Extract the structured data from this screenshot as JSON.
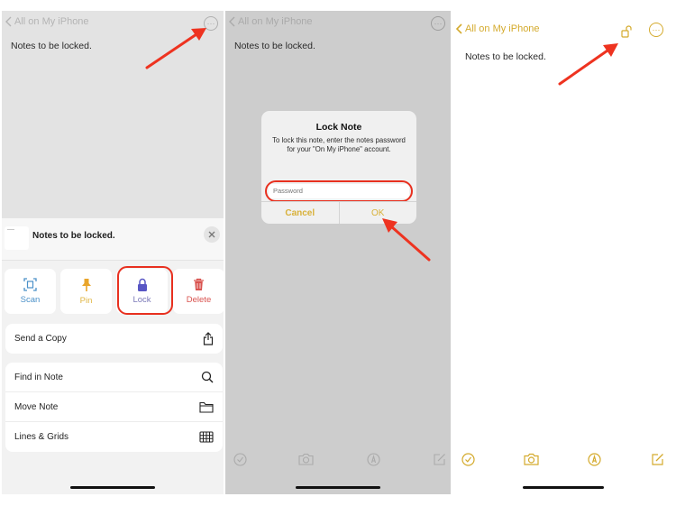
{
  "step1": {
    "back_label": "All on My iPhone",
    "note_text": "Notes to be locked.",
    "sheet": {
      "note_title": "Notes to be locked.",
      "actions": [
        {
          "label": "Scan",
          "icon": "scan-icon",
          "color": "#4a90c8"
        },
        {
          "label": "Pin",
          "icon": "pin-icon",
          "color": "#e9a52b"
        },
        {
          "label": "Lock",
          "icon": "lock-icon",
          "color": "#5856c4"
        },
        {
          "label": "Delete",
          "icon": "trash-icon",
          "color": "#d9534f"
        }
      ],
      "send_copy": {
        "label": "Send a Copy",
        "icon": "share-icon"
      },
      "menu": [
        {
          "label": "Find in Note",
          "icon": "search-icon"
        },
        {
          "label": "Move Note",
          "icon": "folder-icon"
        },
        {
          "label": "Lines & Grids",
          "icon": "grid-icon"
        }
      ]
    }
  },
  "step2": {
    "back_label": "All on My iPhone",
    "note_text": "Notes to be locked.",
    "dialog": {
      "title": "Lock Note",
      "message": "To lock this note, enter the notes password for your \"On My iPhone\" account.",
      "password_placeholder": "Password",
      "password_value": "",
      "cancel_label": "Cancel",
      "ok_label": "OK"
    },
    "toolbar": [
      "checklist-icon",
      "camera-icon",
      "markup-icon",
      "compose-icon"
    ]
  },
  "step3": {
    "back_label": "All on My iPhone",
    "note_text": "Notes to be locked.",
    "toolbar": [
      "checklist-icon",
      "camera-icon",
      "markup-icon",
      "compose-icon"
    ]
  },
  "colors": {
    "accent": "#d4aa2c",
    "highlight": "#e8301f",
    "lock": "#5856c4"
  }
}
